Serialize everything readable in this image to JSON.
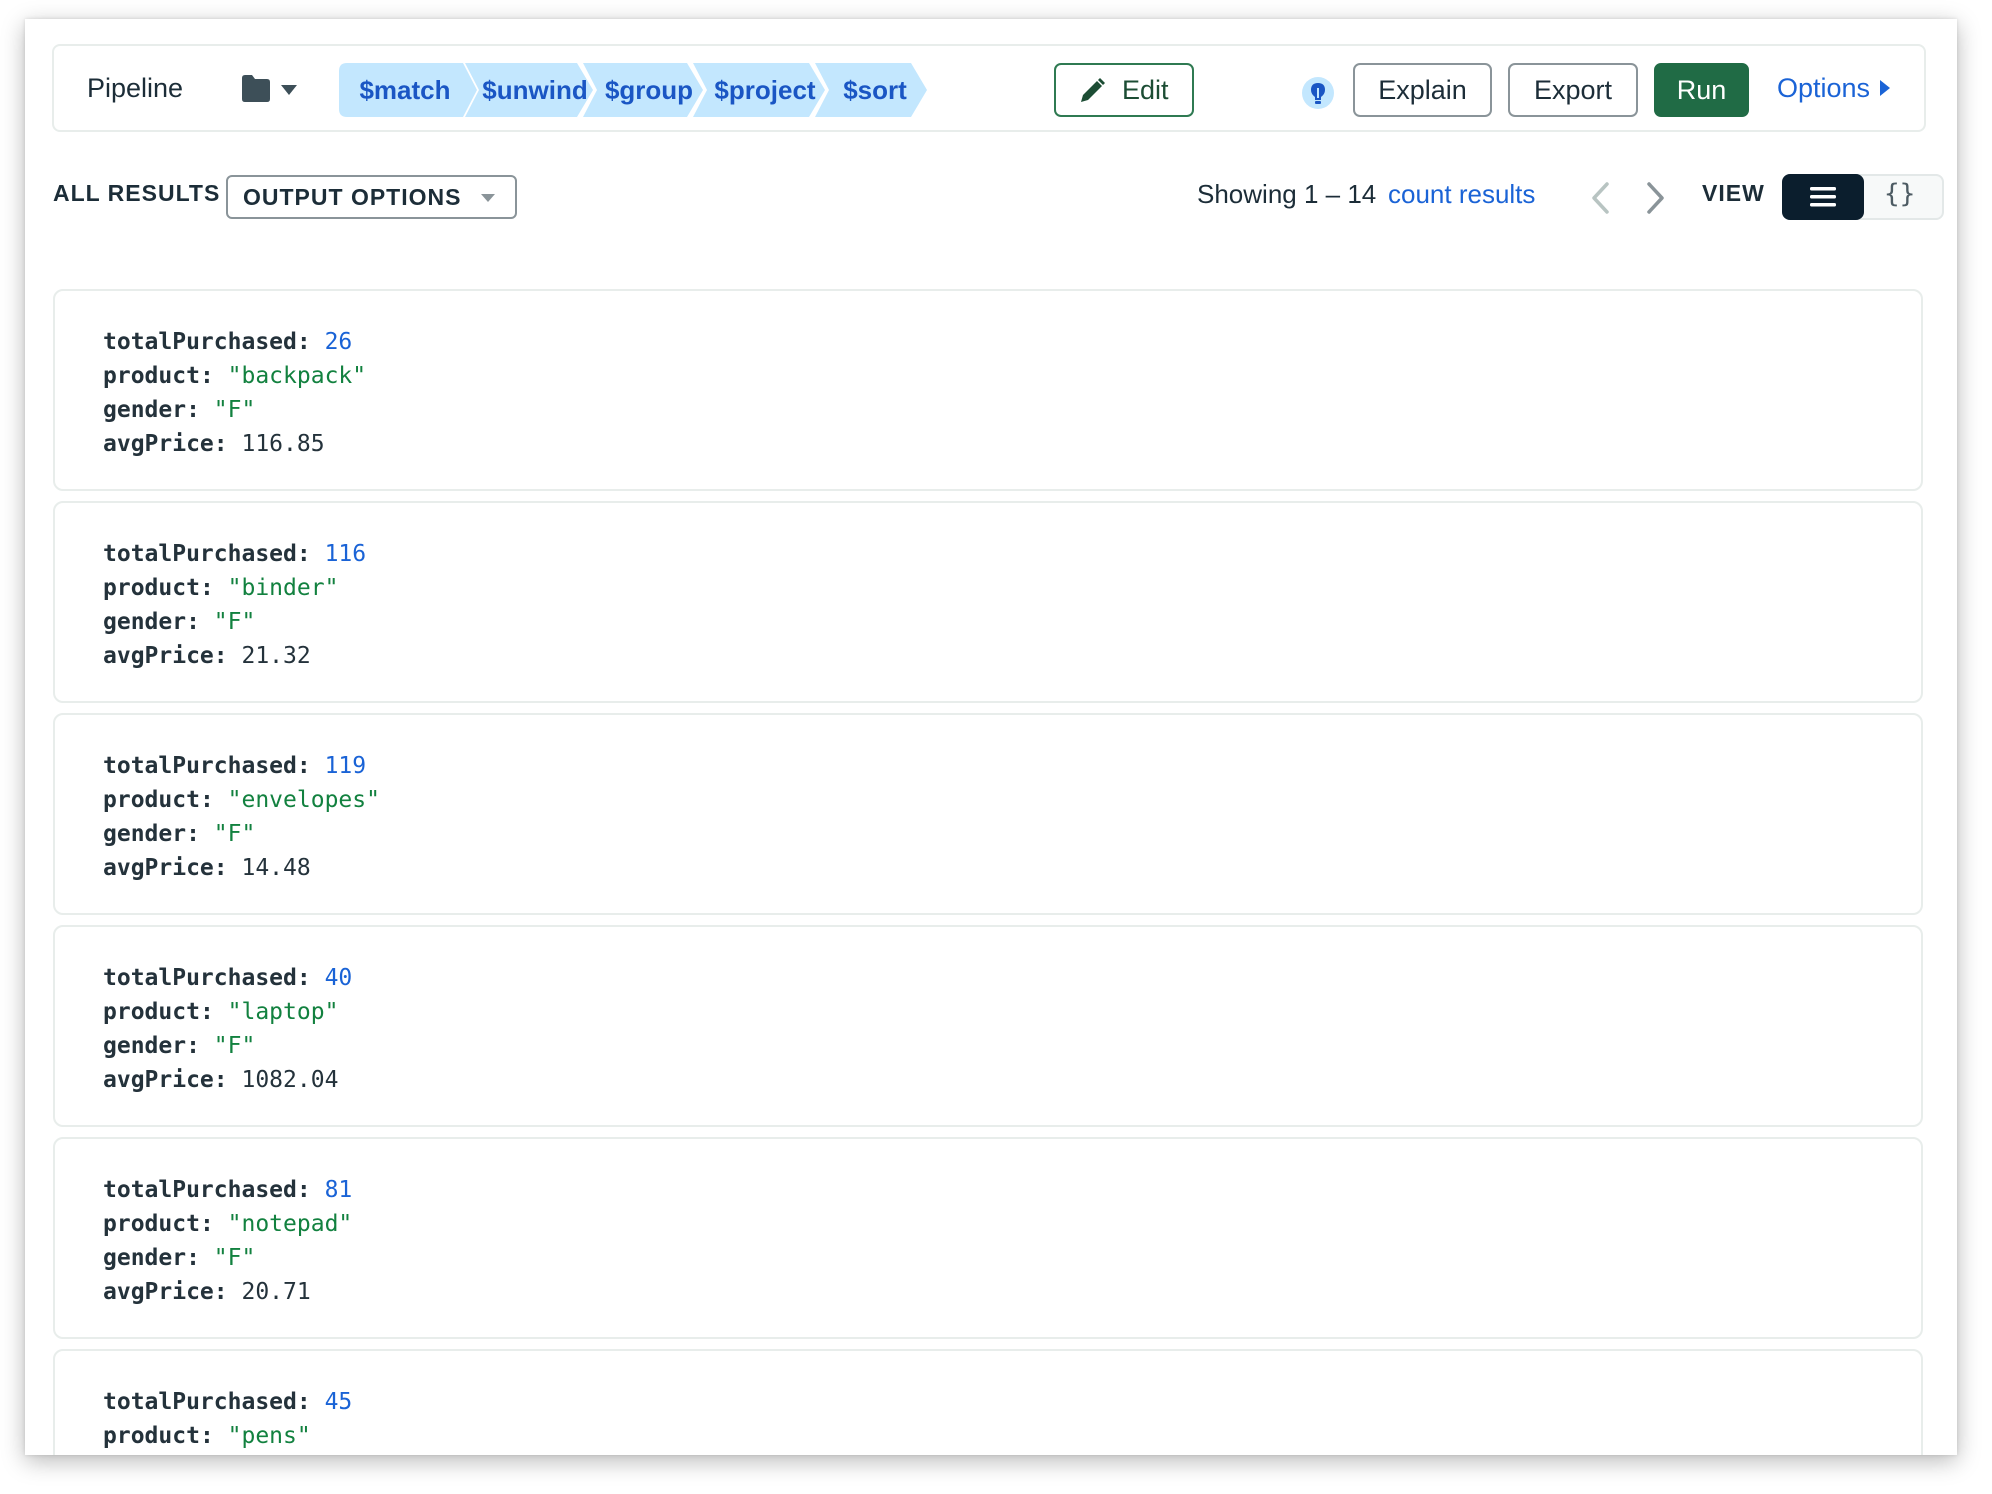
{
  "toolbar": {
    "title": "Pipeline",
    "stages": [
      "$match",
      "$unwind",
      "$group",
      "$project",
      "$sort"
    ],
    "edit_label": "Edit",
    "explain_label": "Explain",
    "export_label": "Export",
    "run_label": "Run",
    "options_label": "Options"
  },
  "results": {
    "all_results_label": "ALL RESULTS",
    "output_options_label": "OUTPUT OPTIONS",
    "showing": "Showing 1 – 14",
    "count_link": "count results",
    "view_label": "VIEW",
    "json_view_glyph": "{}"
  },
  "documents": [
    {
      "totalPurchased": "26",
      "product": "\"backpack\"",
      "gender": "\"F\"",
      "avgPrice": "116.85"
    },
    {
      "totalPurchased": "116",
      "product": "\"binder\"",
      "gender": "\"F\"",
      "avgPrice": "21.32"
    },
    {
      "totalPurchased": "119",
      "product": "\"envelopes\"",
      "gender": "\"F\"",
      "avgPrice": "14.48"
    },
    {
      "totalPurchased": "40",
      "product": "\"laptop\"",
      "gender": "\"F\"",
      "avgPrice": "1082.04"
    },
    {
      "totalPurchased": "81",
      "product": "\"notepad\"",
      "gender": "\"F\"",
      "avgPrice": "20.71"
    },
    {
      "totalPurchased": "45",
      "product": "\"pens\""
    }
  ],
  "field_keys": [
    "totalPurchased",
    "product",
    "gender",
    "avgPrice"
  ],
  "colors": {
    "run_button": "#206b45",
    "stage_fill": "#c3e7fe",
    "stage_text": "#1a56c4",
    "link": "#1a63d6",
    "number_value": "#1a63d6",
    "string_value": "#12813f",
    "active_view": "#0b1e2d"
  },
  "icons": {
    "folder": "folder-icon",
    "dropdown": "chevron-down-icon",
    "edit": "pencil-icon",
    "bulb": "lightbulb-icon",
    "options": "caret-right-icon",
    "prev": "chevron-left-icon",
    "next": "chevron-right-icon",
    "list_view": "list-icon",
    "json_view": "braces-icon"
  }
}
